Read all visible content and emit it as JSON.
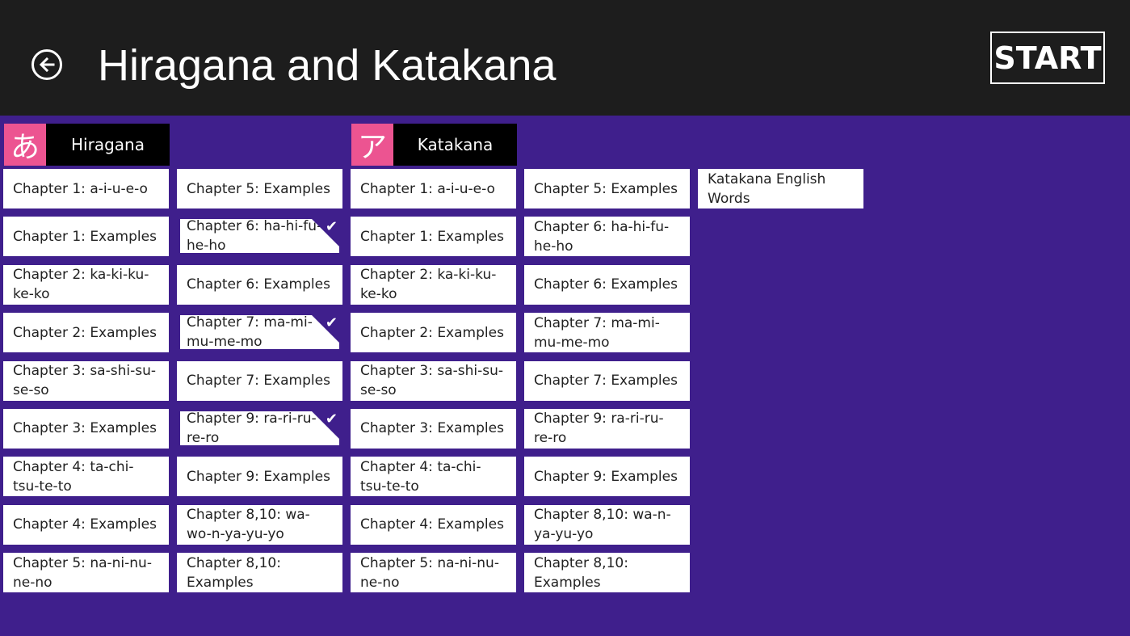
{
  "header": {
    "title": "Hiragana and Katakana",
    "start_label": "START"
  },
  "sections": {
    "hiragana": {
      "glyph": "あ",
      "label": "Hiragana"
    },
    "katakana": {
      "glyph": "ア",
      "label": "Katakana"
    }
  },
  "colors": {
    "background": "#3f1f8c",
    "topbar": "#1d1d1d",
    "accent": "#ec5491"
  },
  "hiragana_col1": [
    "Chapter 1: a-i-u-e-o",
    "Chapter 1: Examples",
    "Chapter 2: ka-ki-ku-ke-ko",
    "Chapter 2: Examples",
    "Chapter 3: sa-shi-su-se-so",
    "Chapter 3: Examples",
    "Chapter 4: ta-chi-tsu-te-to",
    "Chapter 4: Examples",
    "Chapter 5: na-ni-nu-ne-no"
  ],
  "hiragana_col2": [
    "Chapter 5: Examples",
    "Chapter 6: ha-hi-fu-he-ho",
    "Chapter 6: Examples",
    "Chapter 7: ma-mi-mu-me-mo",
    "Chapter 7: Examples",
    "Chapter 9: ra-ri-ru-re-ro",
    "Chapter 9: Examples",
    "Chapter 8,10: wa-wo-n-ya-yu-yo",
    "Chapter 8,10: Examples"
  ],
  "katakana_col1": [
    "Chapter 1: a-i-u-e-o",
    "Chapter 1: Examples",
    "Chapter 2: ka-ki-ku-ke-ko",
    "Chapter 2: Examples",
    "Chapter 3: sa-shi-su-se-so",
    "Chapter 3: Examples",
    "Chapter 4: ta-chi-tsu-te-to",
    "Chapter 4: Examples",
    "Chapter 5: na-ni-nu-ne-no"
  ],
  "katakana_col2": [
    "Chapter 5: Examples",
    "Chapter 6: ha-hi-fu-he-ho",
    "Chapter 6: Examples",
    "Chapter 7: ma-mi-mu-me-mo",
    "Chapter 7: Examples",
    "Chapter 9: ra-ri-ru-re-ro",
    "Chapter 9: Examples",
    "Chapter 8,10: wa-n-ya-yu-yo",
    "Chapter 8,10: Examples"
  ],
  "katakana_col3": [
    "Katakana English Words"
  ],
  "checked": {
    "hiragana_col2": [
      1,
      3,
      5
    ]
  },
  "icons": {
    "back": "back-arrow-icon",
    "check": "checkmark-icon"
  }
}
